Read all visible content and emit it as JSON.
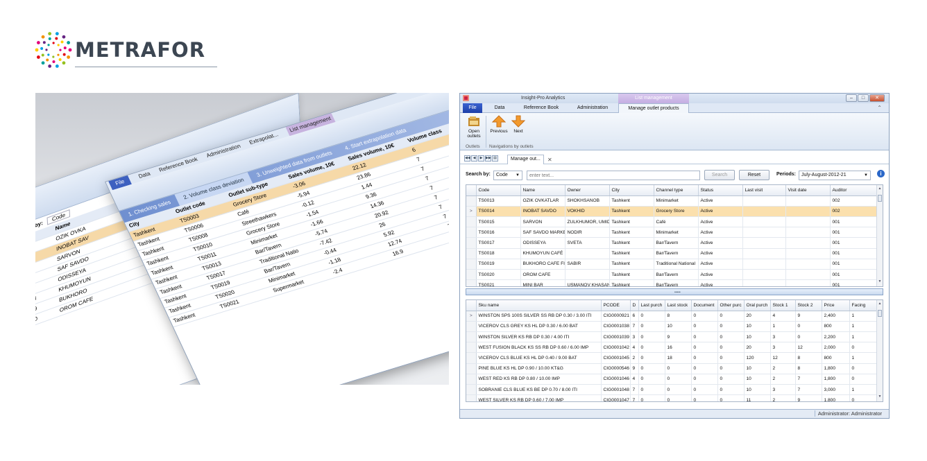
{
  "logo": {
    "text": "METRAFOR"
  },
  "collage": {
    "front": {
      "tabs": [
        "File",
        "Data",
        "Reference Book",
        "Administration",
        "Extrapolat...",
        "List management"
      ],
      "steps": [
        "1. Checking sales",
        "2. Volume class deviation",
        "3. Unweighted data from outlets",
        "4. Start extrapolation data"
      ],
      "header": [
        "City",
        "Outlet code",
        "Outlet sub-type",
        "Sales volume, 10€",
        "Sales volume, 10€",
        "Volume class"
      ],
      "rows": [
        [
          "Tashkent",
          "TS0003",
          "Grocery Store",
          "-3.06",
          "22.12",
          "6"
        ],
        [
          "Tashkent",
          "TS0006",
          "Café",
          "-5.94",
          "23.86",
          "7"
        ],
        [
          "Tashkent",
          "TS0008",
          "Streethawkers",
          "-0.12",
          "1.44",
          "7"
        ],
        [
          "Tashkent",
          "TS0010",
          "Grocery Store",
          "-1.54",
          "9.36",
          "7"
        ],
        [
          "Tashkent",
          "TS0011",
          "Minimarket",
          "-1.66",
          "14.36",
          "7"
        ],
        [
          "Tashkent",
          "TS0013",
          "Bar/Tavern",
          "-5.74",
          "20.92",
          "7"
        ],
        [
          "Tashkent",
          "TS0017",
          "Traditional Natio",
          "-7.42",
          "26",
          "7"
        ],
        [
          "Tashkent",
          "TS0019",
          "Bar/Tavern",
          "-0.44",
          "5.92",
          "7"
        ],
        [
          "Tashkent",
          "TS0020",
          "Minimarket",
          "-1.18",
          "12.74",
          "7"
        ],
        [
          "Tashkent",
          "TS0021",
          "Supermarket",
          "-2.4",
          "16.9",
          "7"
        ]
      ]
    },
    "back": {
      "search_label": "Search by:",
      "search_value": "Code",
      "header": [
        "Code",
        "Name"
      ],
      "rows": [
        [
          "TS0013",
          "OZIK OVKA"
        ],
        [
          "TS0014",
          "INOBAT SAV"
        ],
        [
          "TS0015",
          "SARVON"
        ],
        [
          "TS0016",
          "SAF SAVDO"
        ],
        [
          "TS0017",
          "ODISSEYA"
        ],
        [
          "TS0018",
          "KHUMOYUN"
        ],
        [
          "TS0019",
          "BUKHORO"
        ],
        [
          "TS0020",
          "OROM CAFE"
        ]
      ]
    }
  },
  "window": {
    "title": "Insight-Pro Analytics",
    "context_title": "List management",
    "tabs": {
      "file": "File",
      "data": "Data",
      "reference": "Reference Book",
      "admin": "Administration",
      "active": "Manage outlet products"
    },
    "ribbon": {
      "open_outlets": "Open outlets",
      "previous": "Previous",
      "next": "Next",
      "group_outlets": "Outlets",
      "group_nav": "Navigations by outlets"
    },
    "doc_tab": "Manage out...",
    "search": {
      "label": "Search by:",
      "field": "Code",
      "placeholder": "enter text...",
      "search_btn": "Search",
      "reset_btn": "Reset",
      "periods_label": "Periods:",
      "periods_value": "July-August-2012-21"
    },
    "outlets": {
      "columns": [
        "",
        "Code",
        "Name",
        "Owner",
        "City",
        "Channel type",
        "Status",
        "Last visit",
        "Visit date",
        "Auditor"
      ],
      "rows": [
        {
          "ind": "",
          "cells": [
            "TS0013",
            "OZIK OVKATLAR",
            "SHOKHSANOB",
            "Tashkent",
            "Minimarket",
            "Active",
            "",
            "",
            "002"
          ]
        },
        {
          "ind": ">",
          "cells": [
            "TS0014",
            "INOBAT SAVDO",
            "VOKHID",
            "Tashkent",
            "Grocery Store",
            "Active",
            "",
            "",
            "002"
          ],
          "selected": true
        },
        {
          "ind": "",
          "cells": [
            "TS0015",
            "SARVON",
            "ZULKHUMOR, UMIDA",
            "Tashkent",
            "Café",
            "Active",
            "",
            "",
            "001"
          ]
        },
        {
          "ind": "",
          "cells": [
            "TS0016",
            "SAF SAVDO MARKET",
            "NODIR",
            "Tashkent",
            "Minimarket",
            "Active",
            "",
            "",
            "001"
          ]
        },
        {
          "ind": "",
          "cells": [
            "TS0017",
            "ODISSEYA",
            "SVETA",
            "Tashkent",
            "Bar/Tavern",
            "Active",
            "",
            "",
            "001"
          ]
        },
        {
          "ind": "",
          "cells": [
            "TS0018",
            "KHUMOYUN CAFÉ",
            "",
            "Tashkent",
            "Bar/Tavern",
            "Active",
            "",
            "",
            "001"
          ]
        },
        {
          "ind": "",
          "cells": [
            "TS0019",
            "BUKHORO CAFE FIRDAVS",
            "SABIR",
            "Tashkent",
            "Traditional National",
            "Active",
            "",
            "",
            "001"
          ]
        },
        {
          "ind": "",
          "cells": [
            "TS0020",
            "OROM CAFE",
            "",
            "Tashkent",
            "Bar/Tavern",
            "Active",
            "",
            "",
            "001"
          ]
        },
        {
          "ind": "",
          "cells": [
            "TS0021",
            "MINI BAR",
            "USMANOV KHASAN",
            "Tashkent",
            "Bar/Tavern",
            "Active",
            "",
            "",
            "001"
          ]
        }
      ]
    },
    "products": {
      "columns": [
        "",
        "Sku name",
        "PCODE",
        "D",
        "Last purch",
        "Last stock",
        "Document",
        "Other purc",
        "Oral purch",
        "Stock 1",
        "Stock 2",
        "Price",
        "Facing"
      ],
      "rows": [
        {
          "ind": ">",
          "cells": [
            "WINSTON SPS 100S SILVER SS RB DP 0.30 / 3.00 ITI",
            "CIG0000921",
            "6",
            "0",
            "8",
            "0",
            "0",
            "20",
            "4",
            "9",
            "2,400",
            "1"
          ]
        },
        {
          "ind": "",
          "cells": [
            "VICEROV CLS GREY KS HL DP 0.30 / 6.00 BAT",
            "CIG0001038",
            "7",
            "0",
            "10",
            "0",
            "0",
            "10",
            "1",
            "0",
            "800",
            "1"
          ]
        },
        {
          "ind": "",
          "cells": [
            "WINSTON SILVER KS RB DP 0.30 / 4.00 ITI",
            "CIG0001039",
            "3",
            "0",
            "9",
            "0",
            "0",
            "10",
            "3",
            "0",
            "2,200",
            "1"
          ]
        },
        {
          "ind": "",
          "cells": [
            "WEST FUSION BLACK KS SS RB DP 0.60 / 6.00 IMP",
            "CIG0001042",
            "4",
            "0",
            "16",
            "0",
            "0",
            "20",
            "3",
            "12",
            "2,000",
            "0"
          ]
        },
        {
          "ind": "",
          "cells": [
            "VICEROV CLS BLUE KS HL DP 0.40 / 9.00 BAT",
            "CIG0001045",
            "2",
            "0",
            "18",
            "0",
            "0",
            "120",
            "12",
            "8",
            "800",
            "1"
          ]
        },
        {
          "ind": "",
          "cells": [
            "PINE BLUE KS HL DP 0.90 / 10.00 KT&G",
            "CIG0000546",
            "9",
            "0",
            "0",
            "0",
            "0",
            "10",
            "2",
            "8",
            "1,800",
            "0"
          ]
        },
        {
          "ind": "",
          "cells": [
            "WEST RED KS RB DP 0.80 / 10.00 IMP",
            "CIG0001046",
            "4",
            "0",
            "0",
            "0",
            "0",
            "10",
            "2",
            "7",
            "1,800",
            "0"
          ]
        },
        {
          "ind": "",
          "cells": [
            "SOBRANIE CLS BLUE KS BE DP 0.70 / 8.00 ITI",
            "CIG0001048",
            "7",
            "0",
            "0",
            "0",
            "0",
            "10",
            "3",
            "7",
            "3,000",
            "1"
          ]
        },
        {
          "ind": "",
          "cells": [
            "WEST SILVER KS RB DP 0.60 / 7.00 IMP",
            "CIG0001047",
            "7",
            "0",
            "0",
            "0",
            "0",
            "11",
            "2",
            "9",
            "1,800",
            "0"
          ]
        }
      ]
    },
    "status": "Administrator: Administrator"
  }
}
